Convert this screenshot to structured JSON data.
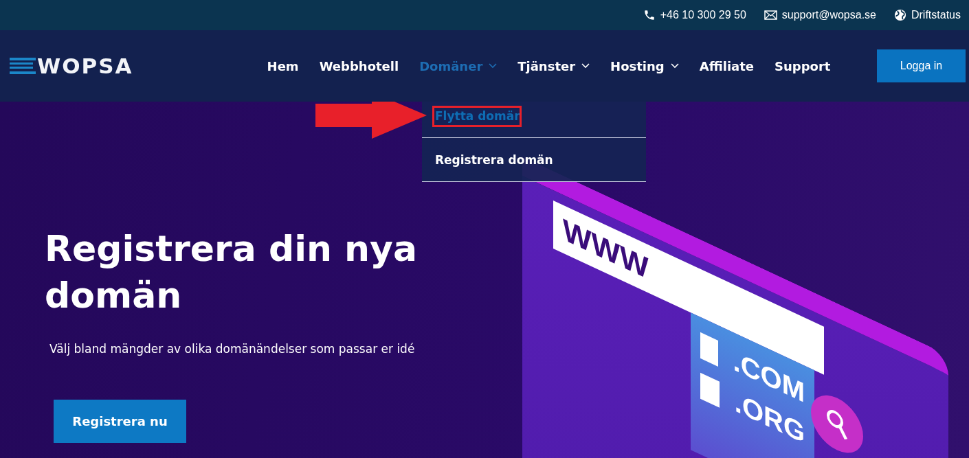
{
  "top_bar": {
    "phone": "+46 10 300 29 50",
    "email": "support@wopsa.se",
    "status_link": "Driftstatus"
  },
  "nav": {
    "logo": "WOPSA",
    "items": [
      {
        "label": "Hem",
        "dropdown": false,
        "selected": false
      },
      {
        "label": "Webbhotell",
        "dropdown": false,
        "selected": false
      },
      {
        "label": "Domäner",
        "dropdown": true,
        "selected": true
      },
      {
        "label": "Tjänster",
        "dropdown": true,
        "selected": false
      },
      {
        "label": "Hosting",
        "dropdown": true,
        "selected": false
      },
      {
        "label": "Affiliate",
        "dropdown": false,
        "selected": false
      },
      {
        "label": "Support",
        "dropdown": false,
        "selected": false
      }
    ],
    "login_button": "Logga in"
  },
  "dropdown_menu": {
    "items": [
      {
        "label": "Flytta domän",
        "selected": true
      },
      {
        "label": "Registrera domän",
        "selected": false
      }
    ]
  },
  "hero": {
    "title": "Registrera din nya domän",
    "subtitle": "Välj bland mängder av olika domänändelser som passar er idé",
    "button": "Registrera nu"
  },
  "illustration": {
    "address_bar": "WWW",
    "domain_options": [
      ".COM",
      ".ORG"
    ]
  }
}
